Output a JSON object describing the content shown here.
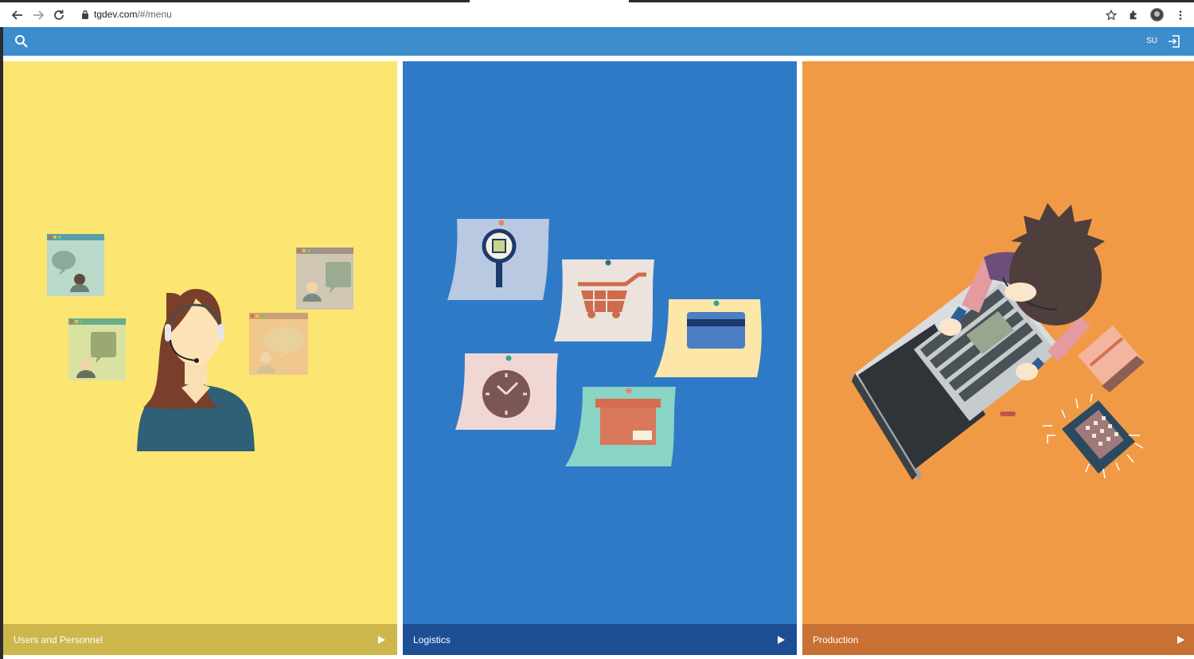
{
  "browser": {
    "url_host": "tgdev.com",
    "url_path": "/#/menu"
  },
  "appbar": {
    "user_initials": "SU",
    "colors": {
      "bar": "#3d8ccc"
    }
  },
  "tiles": [
    {
      "label": "Users and Personnel",
      "bg": "#fce571",
      "footer": "#cdb74d",
      "icon": "play-icon"
    },
    {
      "label": "Logistics",
      "bg": "#2f7ac7",
      "footer": "#1e4f95",
      "icon": "play-icon"
    },
    {
      "label": "Production",
      "bg": "#f19a45",
      "footer": "#c97034",
      "icon": "play-icon"
    }
  ]
}
